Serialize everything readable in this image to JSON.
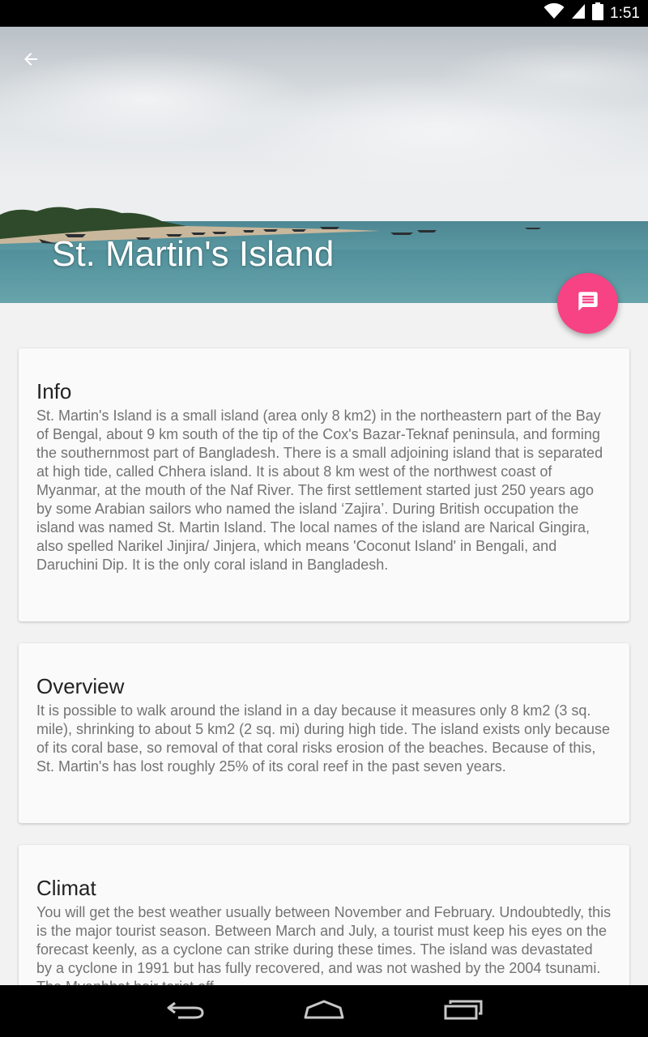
{
  "status_bar": {
    "time": "1:51",
    "icons": [
      "wifi-icon",
      "signal-icon",
      "battery-icon"
    ]
  },
  "header": {
    "title": "St. Martin's Island",
    "back_icon": "arrow-left-icon"
  },
  "fab": {
    "icon": "message-icon",
    "color": "#f74283"
  },
  "cards": [
    {
      "title": "Info",
      "body": "St. Martin's Island is a small island (area only 8 km2) in the northeastern part of the Bay of Bengal, about 9 km south of the tip of the Cox's Bazar-Teknaf peninsula, and forming the southernmost part of Bangladesh. There is a small adjoining island that is separated at high tide, called Chhera island. It is about 8 km west of the northwest coast of Myanmar, at the mouth of the Naf River. The first settlement started just 250 years ago by some Arabian sailors who named the island ‘Zajira’. During British occupation the island was named St. Martin Island. The local names of the island are Narical Gingira, also spelled Narikel Jinjira/ Jinjera, which means 'Coconut Island' in Bengali, and Daruchini Dip. It is the only coral island in Bangladesh."
    },
    {
      "title": "Overview",
      "body": "It is possible to walk around the island in a day because it measures only 8 km2 (3 sq. mile), shrinking to about 5 km2 (2 sq. mi) during high tide. The island exists only because of its coral base, so removal of that coral risks erosion of the beaches. Because of this, St. Martin's has lost roughly 25% of its coral reef in the past seven years."
    },
    {
      "title": "Climat",
      "body": "You will get the best weather usually between November and February. Undoubtedly, this is the major tourist season. Between March and July, a tourist must keep his eyes on the forecast keenly, as a cyclone can strike during these times. The island was devastated by a cyclone in 1991 but has fully recovered, and was not washed by the 2004 tsunami. The Myanbhat bajr torist off"
    }
  ],
  "nav_bar": {
    "icons": [
      "back-nav-icon",
      "home-nav-icon",
      "recents-nav-icon"
    ]
  }
}
